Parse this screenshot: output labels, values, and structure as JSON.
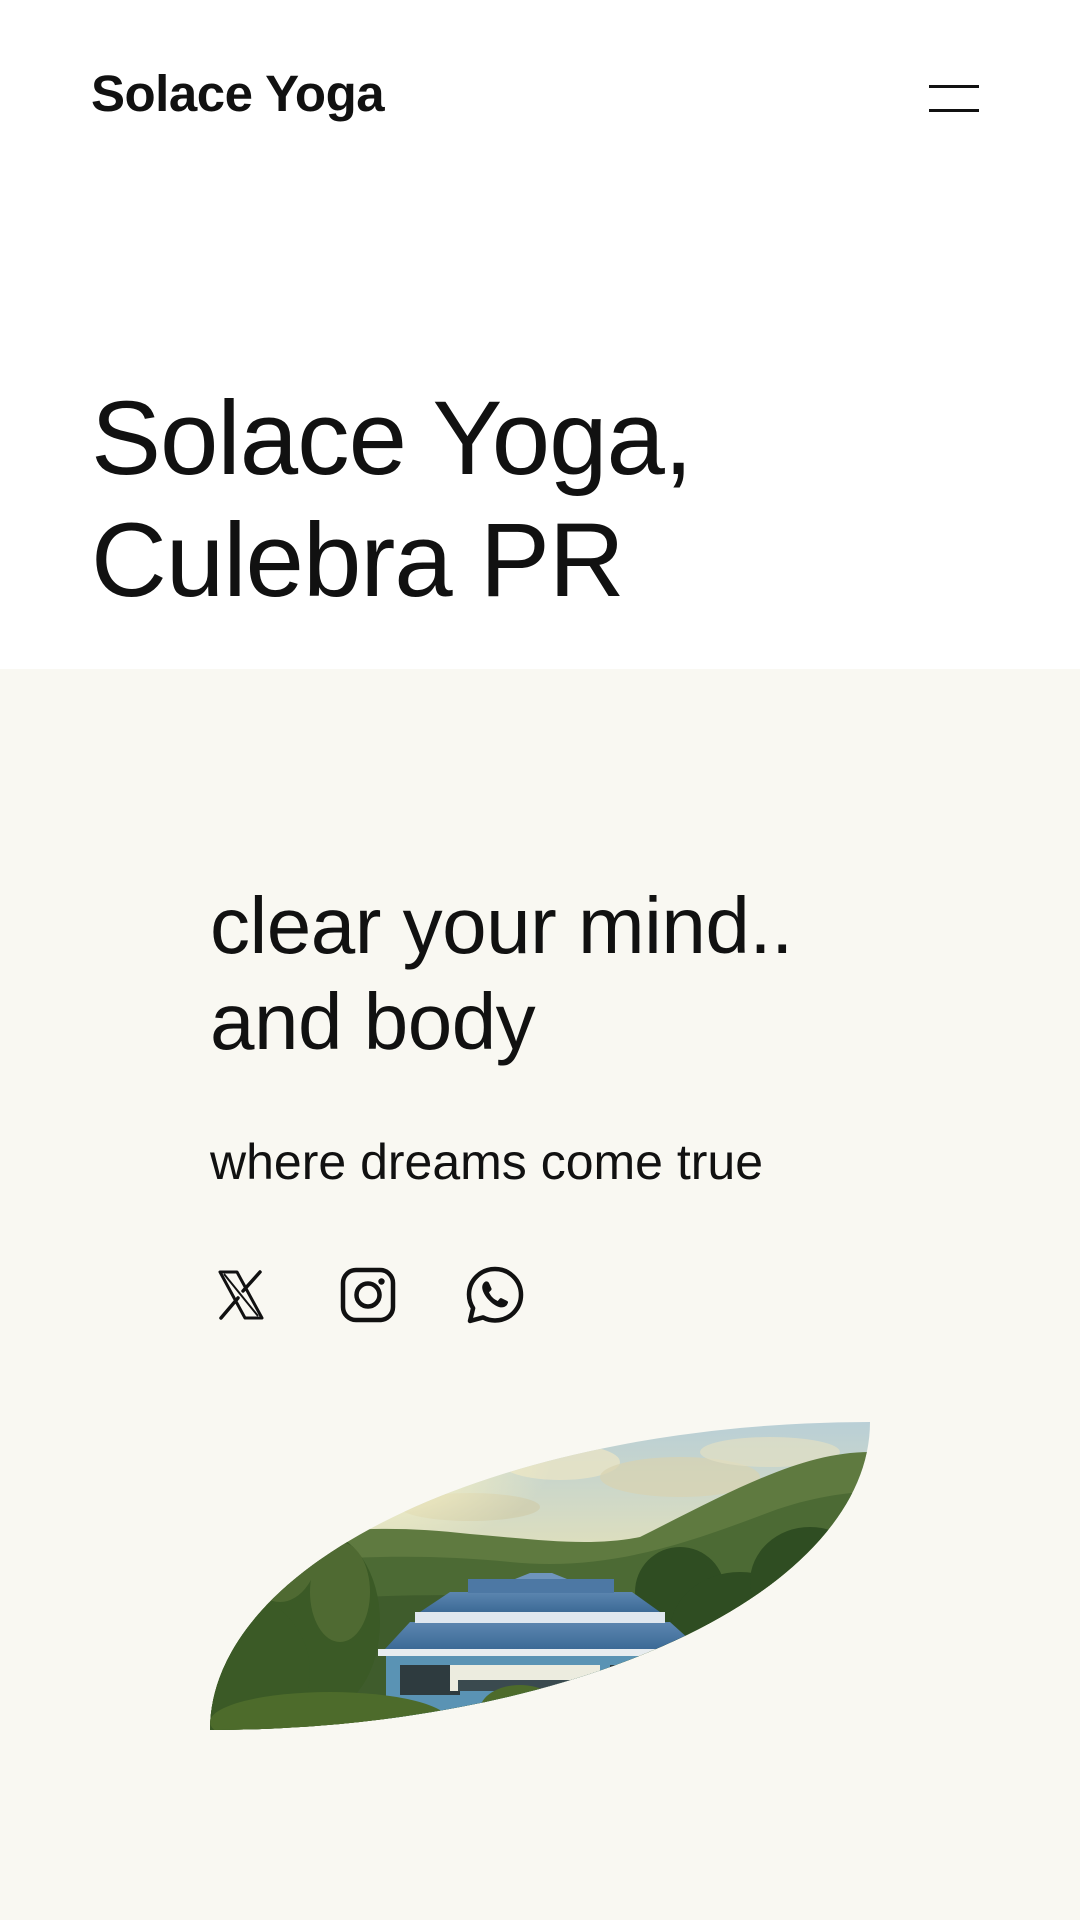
{
  "header": {
    "site_title": "Solace Yoga",
    "menu_icon": "hamburger-menu-icon"
  },
  "page": {
    "title_line1": "Solace Yoga,",
    "title_line2": "Culebra PR"
  },
  "hero": {
    "heading_line1": "clear your mind..",
    "heading_line2": "and body",
    "subheading": "where dreams come true",
    "social_icons": [
      "x-icon",
      "instagram-icon",
      "whatsapp-icon"
    ],
    "image_alt": "Blue-roofed yoga studio building among green hills at sunrise",
    "background_color": "#f9f8f2"
  }
}
